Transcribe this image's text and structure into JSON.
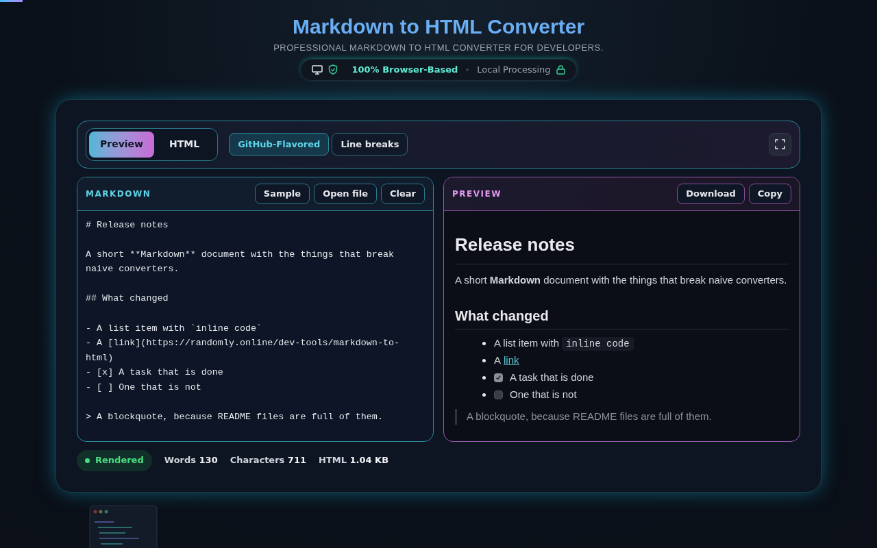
{
  "header": {
    "title": "Markdown to HTML Converter",
    "subtitle": "PROFESSIONAL MARKDOWN TO HTML CONVERTER FOR DEVELOPERS.",
    "badge": {
      "primary": "100% Browser-Based",
      "secondary": "Local Processing"
    }
  },
  "toolbar": {
    "view_tabs": [
      {
        "label": "Preview",
        "selected": true
      },
      {
        "label": "HTML",
        "selected": false
      }
    ],
    "options": [
      {
        "label": "GitHub-Flavored",
        "on": true
      },
      {
        "label": "Line breaks",
        "on": false
      }
    ]
  },
  "markdown_panel": {
    "title": "MARKDOWN",
    "buttons": [
      "Sample",
      "Open file",
      "Clear"
    ],
    "blocks": [
      [
        "# Release notes"
      ],
      [
        "A short **Markdown** document with the things that break",
        "naive converters."
      ],
      [
        "## What changed"
      ],
      [
        "- A list item with `inline code`",
        "- A [link](https://randomly.online/dev-tools/markdown-to-",
        "html)",
        "- [x] A task that is done",
        "- [ ] One that is not"
      ],
      [
        "> A blockquote, because README files are full of them."
      ]
    ]
  },
  "preview_panel": {
    "title": "PREVIEW",
    "buttons": [
      "Download",
      "Copy"
    ],
    "content": [
      {
        "kind": "h1",
        "text": "Release notes"
      },
      {
        "kind": "p",
        "text": "A short **Markdown** document with the things that break naive converters."
      },
      {
        "kind": "h2",
        "text": "What changed"
      },
      {
        "kind": "list",
        "items": [
          {
            "kind": "code",
            "text": "A list item with",
            "code": "inline code"
          },
          {
            "kind": "link",
            "text": "A",
            "link": "link"
          },
          {
            "kind": "task",
            "text": "A task that is done",
            "checked": true
          },
          {
            "kind": "task",
            "text": "One that is not",
            "checked": false
          }
        ]
      },
      {
        "kind": "quote",
        "text": "A blockquote, because README files are full of them."
      }
    ]
  },
  "status": {
    "state": "Rendered",
    "stats": [
      {
        "label": "Words",
        "value": "130"
      },
      {
        "label": "Characters",
        "value": "711"
      },
      {
        "label": "HTML",
        "value": "1.04 KB"
      }
    ]
  }
}
